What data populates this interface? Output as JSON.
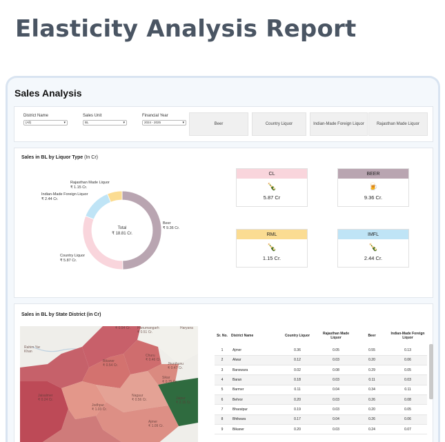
{
  "page_title": "Elasticity Analysis Report",
  "report": {
    "title": "Sales Analysis",
    "filters": [
      {
        "label": "District Name",
        "value": "(All)"
      },
      {
        "label": "Sales Unit",
        "value": "BL"
      },
      {
        "label": "Financial Year",
        "value": "2024 - 2025"
      }
    ],
    "type_buttons": [
      "Beer",
      "Country Liquor",
      "Indian-Made Foreign Liquor",
      "Rajasthan Made Liquor"
    ]
  },
  "liquor_section": {
    "title": "Sales in BL by Liquor Type",
    "unit": "(In Cr)",
    "center_label": "Total",
    "center_value": "₹ 18.81 Cr.",
    "slice_labels": [
      {
        "name": "Beer",
        "value": "₹ 9.36 Cr."
      },
      {
        "name": "Country Liquor",
        "value": "₹ 5.87 Cr."
      },
      {
        "name": "Indian-Made Foreign Liquor",
        "value": "₹ 2.44 Cr."
      },
      {
        "name": "Rajasthan Made Liquor",
        "value": "₹ 1.15 Cr."
      }
    ],
    "cards": [
      {
        "title": "CL",
        "value": "5.87 Cr",
        "color": "#f9d5dc"
      },
      {
        "title": "BEER",
        "value": "9.36 Cr.",
        "color": "#b9a5b1"
      },
      {
        "title": "RML",
        "value": "1.15 Cr.",
        "color": "#fbdc92"
      },
      {
        "title": "IMFL",
        "value": "2.44 Cr.",
        "color": "#bfe4f6"
      }
    ]
  },
  "chart_data": {
    "type": "pie",
    "categories": [
      "Beer",
      "Country Liquor",
      "Indian-Made Foreign Liquor",
      "Rajasthan Made Liquor"
    ],
    "values": [
      9.36,
      5.87,
      2.44,
      1.15
    ],
    "colors": [
      "#b9a5b1",
      "#f9d5dc",
      "#bfe4f6",
      "#fbdc92"
    ],
    "total": 18.81
  },
  "district_section": {
    "title": "Sales in BL by State District (in Cr)",
    "map_labels": [
      {
        "name": "Rahim Yar Khan",
        "value": ""
      },
      {
        "name": "Haryana",
        "value": ""
      },
      {
        "name": "Bikaner",
        "value": "₹ 0.54 Cr."
      },
      {
        "name": "Churu",
        "value": "₹ 0.46 Cr."
      },
      {
        "name": "Jhunjhunu",
        "value": "₹ 0.47 Cr."
      },
      {
        "name": "Sikar",
        "value": "₹ 0.75 Cr."
      },
      {
        "name": "Jaisalmer",
        "value": "₹ 0.24 Cr."
      },
      {
        "name": "Jodhpur",
        "value": "₹ 1.03 Cr."
      },
      {
        "name": "Nagaur",
        "value": "₹ 0.56 Cr."
      },
      {
        "name": "Jaipur",
        "value": "₹ 2.15 Cr."
      },
      {
        "name": "Ajmer",
        "value": "₹ 1.09 Cr."
      },
      {
        "name": "Hanumangarh",
        "value": "₹ 0.51 Cr."
      },
      {
        "name": "",
        "value": "₹ 0.54 Cr."
      }
    ],
    "table": {
      "headers": [
        "Sr. No.",
        "District Name",
        "Country Liquor",
        "Rajasthan Made Liquor",
        "Beer",
        "Indian-Made Foreign Liquor"
      ],
      "rows": [
        [
          "1",
          "Ajmer",
          "0.36",
          "0.05",
          "0.55",
          "0.13"
        ],
        [
          "2",
          "Alwar",
          "0.12",
          "0.03",
          "0.20",
          "0.06"
        ],
        [
          "3",
          "Banswara",
          "0.02",
          "0.08",
          "0.29",
          "0.05"
        ],
        [
          "4",
          "Baran",
          "0.18",
          "0.03",
          "0.11",
          "0.03"
        ],
        [
          "5",
          "Barmer",
          "0.11",
          "0.04",
          "0.34",
          "0.11"
        ],
        [
          "6",
          "Behror",
          "0.20",
          "0.03",
          "0.26",
          "0.08"
        ],
        [
          "7",
          "Bharatpur",
          "0.19",
          "0.03",
          "0.20",
          "0.05"
        ],
        [
          "8",
          "Bhilwara",
          "0.17",
          "0.04",
          "0.26",
          "0.06"
        ],
        [
          "9",
          "Bikaner",
          "0.20",
          "0.03",
          "0.24",
          "0.07"
        ]
      ]
    }
  }
}
